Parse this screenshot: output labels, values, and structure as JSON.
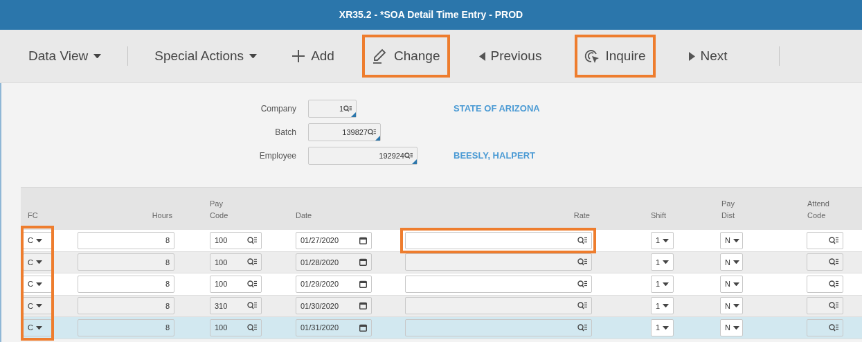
{
  "window": {
    "title": "XR35.2 - *SOA Detail Time Entry - PROD"
  },
  "toolbar": [
    {
      "kind": "menu",
      "label": "Data View",
      "highlighted": false
    },
    {
      "kind": "menu",
      "label": "Special Actions",
      "highlighted": false
    },
    {
      "kind": "add",
      "label": "Add",
      "highlighted": false
    },
    {
      "kind": "change",
      "label": "Change",
      "highlighted": true
    },
    {
      "kind": "previous",
      "label": "Previous",
      "highlighted": false
    },
    {
      "kind": "inquire",
      "label": "Inquire",
      "highlighted": true
    },
    {
      "kind": "next",
      "label": "Next",
      "highlighted": false
    }
  ],
  "header_fields": [
    {
      "label": "Company",
      "value": "1",
      "description": "STATE OF ARIZONA"
    },
    {
      "label": "Batch",
      "value": "139827"
    },
    {
      "label": "Employee",
      "value": "192924",
      "description": "BEESLY, HALPERT"
    }
  ],
  "table": {
    "fc_highlighted": true,
    "columns": [
      {
        "label": "FC"
      },
      {
        "label": "Hours"
      },
      {
        "top": "Pay",
        "label": "Code"
      },
      {
        "label": "Date"
      },
      {
        "label": "Rate"
      },
      {
        "label": "Shift"
      },
      {
        "top": "Pay",
        "label": "Dist"
      },
      {
        "top": "Attend",
        "label": "Code"
      }
    ],
    "rows": [
      {
        "fc": "C",
        "hours": "8",
        "pay_code": "100",
        "date": "01/27/2020",
        "shift": "1",
        "pay_dist": "N",
        "alternate": false,
        "selected": false,
        "rate_highlighted": true
      },
      {
        "fc": "C",
        "hours": "8",
        "pay_code": "100",
        "date": "01/28/2020",
        "shift": "1",
        "pay_dist": "N",
        "alternate": true,
        "selected": false,
        "rate_highlighted": false
      },
      {
        "fc": "C",
        "hours": "8",
        "pay_code": "100",
        "date": "01/29/2020",
        "shift": "1",
        "pay_dist": "N",
        "alternate": false,
        "selected": false,
        "rate_highlighted": false
      },
      {
        "fc": "C",
        "hours": "8",
        "pay_code": "310",
        "date": "01/30/2020",
        "shift": "1",
        "pay_dist": "N",
        "alternate": true,
        "selected": false,
        "rate_highlighted": false
      },
      {
        "fc": "C",
        "hours": "8",
        "pay_code": "100",
        "date": "01/31/2020",
        "shift": "1",
        "pay_dist": "N",
        "alternate": false,
        "selected": true,
        "rate_highlighted": false
      }
    ]
  }
}
